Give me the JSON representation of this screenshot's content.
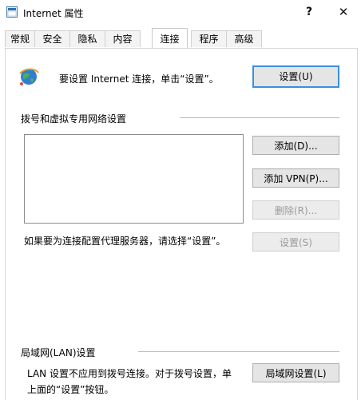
{
  "window": {
    "title": "Internet 属性",
    "help_glyph": "?",
    "close_glyph": "✕"
  },
  "tabs": [
    {
      "label": "常规"
    },
    {
      "label": "安全"
    },
    {
      "label": "隐私"
    },
    {
      "label": "内容"
    },
    {
      "label": "连接",
      "active": true
    },
    {
      "label": "程序"
    },
    {
      "label": "高级"
    }
  ],
  "setup": {
    "text": "要设置 Internet 连接，单击“设置”。",
    "button": "设置(U)"
  },
  "dialup": {
    "group_label": "拨号和虚拟专用网络设置",
    "add_button": "添加(D)...",
    "add_vpn_button": "添加 VPN(P)...",
    "remove_button": "删除(R)...",
    "settings_button": "设置(S)",
    "proxy_text": "如果要为连接配置代理服务器，请选择“设置”。"
  },
  "lan": {
    "group_label": "局域网(LAN)设置",
    "line1": "LAN 设置不应用到拨号连接。对于拨号设置，单",
    "line2": "上面的“设置”按钮。",
    "button": "局域网设置(L)"
  },
  "colors": {
    "accent": "#3c8ee0",
    "button_bg": "#e5e5e5",
    "disabled_text": "#9a9a9a"
  }
}
